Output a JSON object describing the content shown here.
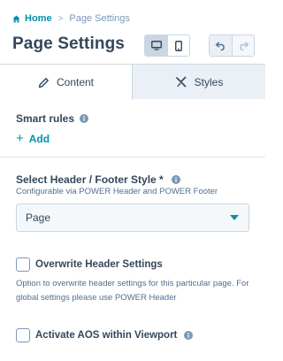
{
  "breadcrumb": {
    "home": "Home",
    "separator": ">",
    "current": "Page Settings"
  },
  "title": "Page Settings",
  "toolbar": {
    "device_buttons": [
      {
        "icon": "desktop-icon",
        "active": true
      },
      {
        "icon": "mobile-icon",
        "active": false
      }
    ],
    "history_buttons": [
      {
        "icon": "undo-icon"
      },
      {
        "icon": "redo-icon"
      }
    ]
  },
  "tabs": [
    {
      "label": "Content",
      "icon": "pencil-icon",
      "selected": true
    },
    {
      "label": "Styles",
      "icon": "brush-icon",
      "selected": false
    }
  ],
  "smart_rules": {
    "label": "Smart rules",
    "add_label": "Add"
  },
  "header_footer": {
    "label": "Select Header / Footer Style *",
    "help": "Configurable via POWER Header and POWER Footer",
    "selected": "Page"
  },
  "overwrite_header": {
    "label": "Overwrite Header Settings",
    "checked": false,
    "help": "Option to overwrite header settings for this particular page. For global settings please use POWER Header"
  },
  "aos": {
    "label": "Activate AOS within Viewport",
    "checked": false
  },
  "colors": {
    "accent": "#0091ae",
    "text": "#33475b",
    "border": "#cbd6e2",
    "inactive_tab": "#eaf0f6"
  }
}
